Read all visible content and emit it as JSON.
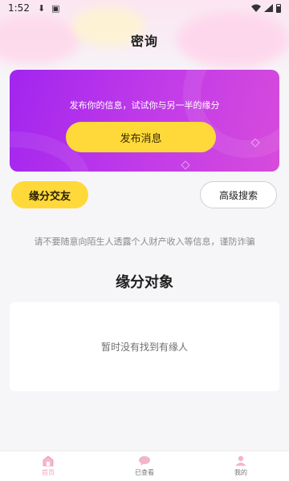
{
  "status_bar": {
    "time": "1:52"
  },
  "header": {
    "title": "密询"
  },
  "hero": {
    "text": "发布你的信息，试试你与另一半的缘分",
    "button_label": "发布消息"
  },
  "actions": {
    "match_label": "缘分交友",
    "advanced_search_label": "高级搜索"
  },
  "warning": "请不要随意向陌生人透露个人财产收入等信息，谨防诈骗",
  "section": {
    "title": "缘分对象",
    "empty_text": "暂时没有找到有缘人"
  },
  "bottom_nav": {
    "items": [
      {
        "label": "首页",
        "icon": "home-icon",
        "active": true
      },
      {
        "label": "已查看",
        "icon": "chat-bubble-icon",
        "active": false
      },
      {
        "label": "我的",
        "icon": "user-icon",
        "active": false
      }
    ]
  },
  "colors": {
    "accent_yellow": "#ffd93a",
    "hero_gradient_start": "#a225ef",
    "hero_gradient_end": "#d74bdb",
    "nav_active": "#f3a2c1"
  }
}
